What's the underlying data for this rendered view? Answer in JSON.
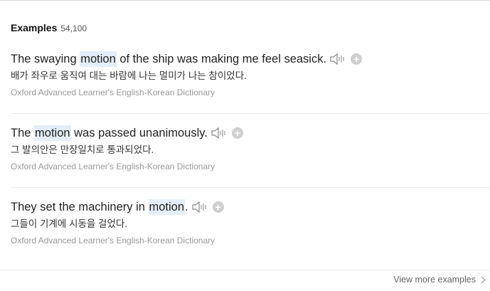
{
  "header": {
    "title": "Examples",
    "count": "54,100"
  },
  "examples": [
    {
      "before": "The swaying ",
      "keyword": "motion",
      "after": " of the ship was making me feel seasick.",
      "translation": "배가 좌우로 움직여 대는 바람에 나는 멀미가 나는 참이었다.",
      "source": "Oxford Advanced Learner's English-Korean Dictionary"
    },
    {
      "before": "The ",
      "keyword": "motion",
      "after": " was passed unanimously.",
      "translation": "그 발의안은 만장일치로 통과되었다.",
      "source": "Oxford Advanced Learner's English-Korean Dictionary"
    },
    {
      "before": "They set the machinery in ",
      "keyword": "motion",
      "after": ".",
      "translation": "그들이 기계에 시동을 걸었다.",
      "source": "Oxford Advanced Learner's English-Korean Dictionary"
    }
  ],
  "footer": {
    "view_more": "View more examples"
  },
  "icons": {
    "audio": "speaker-icon",
    "add": "plus-circle-icon",
    "more": "chevron-right-icon"
  },
  "colors": {
    "highlight": "#e4eef9",
    "source_text": "#999999",
    "plus_button": "#cfcfcf"
  }
}
